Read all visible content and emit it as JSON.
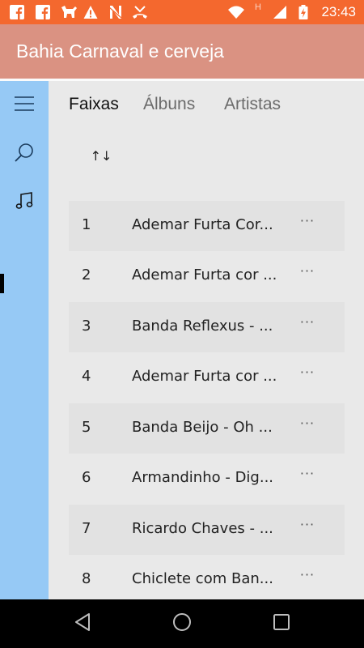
{
  "status_bar": {
    "time": "23:43",
    "icons": [
      "facebook-icon",
      "facebook-icon",
      "pet-notification-icon",
      "warning-icon",
      "n-app-icon",
      "missed-call-icon",
      "wifi-icon",
      "h-network-icon",
      "signal-icon",
      "battery-charging-icon"
    ],
    "network_label": "H"
  },
  "app_bar": {
    "title": "Bahia Carnaval e cerveja"
  },
  "sidebar": {
    "items": [
      "menu-icon",
      "search-icon",
      "music-note-icon"
    ],
    "active_item": "music-note-icon"
  },
  "tabs": [
    {
      "label": "Faixas",
      "active": true
    },
    {
      "label": "Álbuns",
      "active": false
    },
    {
      "label": "Artistas",
      "active": false
    }
  ],
  "sort_button": {
    "icon": "sort-arrows-icon",
    "glyph": "↑↓"
  },
  "tracks": [
    {
      "number": "1",
      "title": "Ademar Furta Cor...",
      "more": "···"
    },
    {
      "number": "2",
      "title": "Ademar Furta cor ...",
      "more": "···"
    },
    {
      "number": "3",
      "title": "Banda Reflexus - ...",
      "more": "···"
    },
    {
      "number": "4",
      "title": "Ademar Furta cor ...",
      "more": "···"
    },
    {
      "number": "5",
      "title": "Banda Beijo - Oh ...",
      "more": "···"
    },
    {
      "number": "6",
      "title": "Armandinho - Dig...",
      "more": "···"
    },
    {
      "number": "7",
      "title": "Ricardo Chaves - ...",
      "more": "···"
    },
    {
      "number": "8",
      "title": "Chiclete com Ban...",
      "more": "···"
    }
  ],
  "nav_bar": {
    "buttons": [
      "back-icon",
      "home-icon",
      "recents-icon"
    ]
  },
  "colors": {
    "status_bar": "#f4682e",
    "app_bar": "#da9282",
    "sidebar": "#96c9f5",
    "background": "#e9e9e9",
    "row_alt": "#e2e2e2",
    "nav_bar": "#000000"
  }
}
